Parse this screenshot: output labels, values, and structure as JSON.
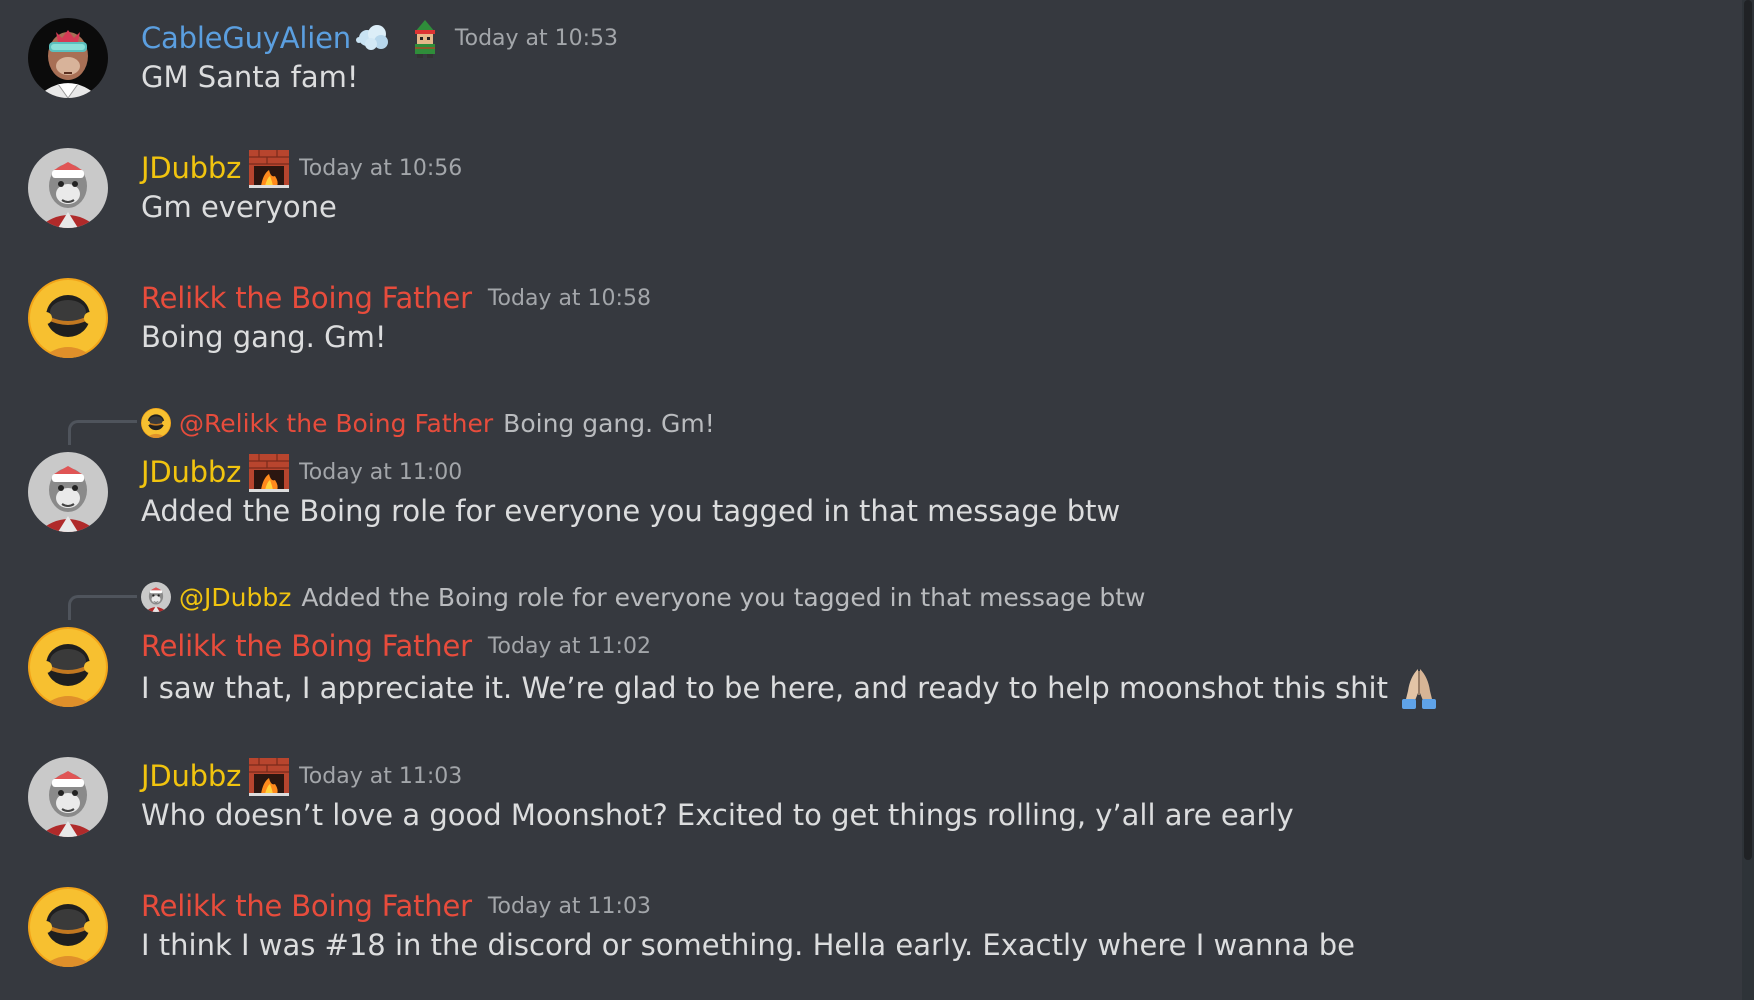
{
  "colors": {
    "background": "#36393f",
    "cableguy": "#5b9fe0",
    "jdubbz": "#f1c40f",
    "relikk": "#e74c3c"
  },
  "messages": [
    {
      "author": "CableGuyAlien",
      "author_badges": [
        "cloud-puff-icon",
        "elf-icon"
      ],
      "timestamp": "Today at 10:53",
      "text": "GM Santa fam!"
    },
    {
      "author": "JDubbz",
      "author_badges": [
        "fireplace-icon"
      ],
      "timestamp": "Today at 10:56",
      "text": "Gm everyone"
    },
    {
      "author": "Relikk the Boing Father",
      "timestamp": "Today at 10:58",
      "text": "Boing gang. Gm!"
    },
    {
      "reply": {
        "author": "@Relikk the Boing Father",
        "text": "Boing gang. Gm!"
      },
      "author": "JDubbz",
      "author_badges": [
        "fireplace-icon"
      ],
      "timestamp": "Today at 11:00",
      "text": "Added the Boing role for everyone you tagged in that message btw"
    },
    {
      "reply": {
        "author": "@JDubbz",
        "text": "Added the Boing role for everyone you tagged in that message btw"
      },
      "author": "Relikk the Boing Father",
      "timestamp": "Today at 11:02",
      "text": "I saw that, I appreciate it. We’re glad to be here, and ready to help moonshot this shit",
      "trailing_emoji": "praying-hands-icon"
    },
    {
      "author": "JDubbz",
      "author_badges": [
        "fireplace-icon"
      ],
      "timestamp": "Today at 11:03",
      "text": "Who doesn’t love a good Moonshot? Excited to get things rolling, y’all are early"
    },
    {
      "author": "Relikk the Boing Father",
      "timestamp": "Today at 11:03",
      "text": "I think I was #18 in the discord or something. Hella early. Exactly where I wanna be"
    }
  ]
}
